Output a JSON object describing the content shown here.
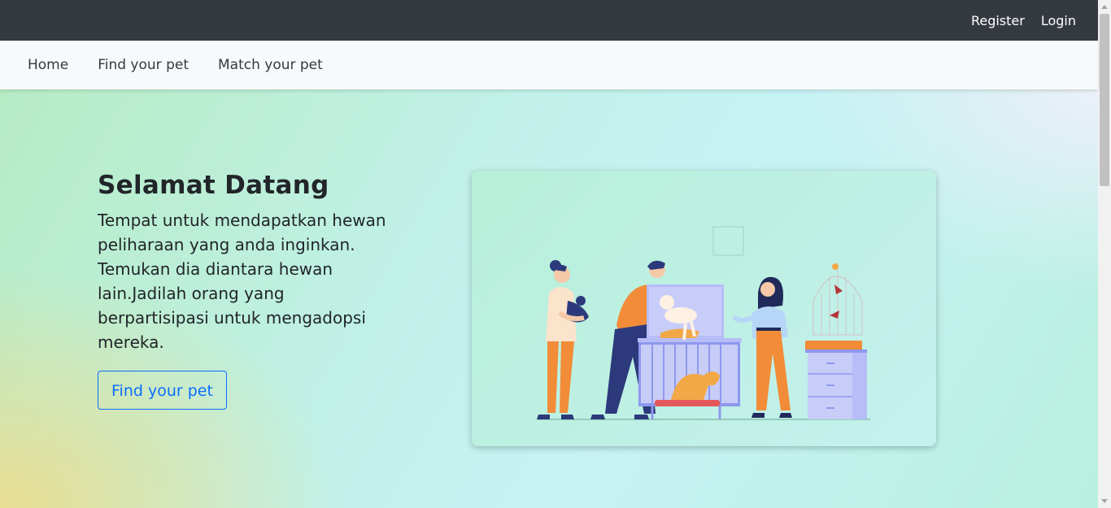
{
  "topbar": {
    "register_label": "Register",
    "login_label": "Login"
  },
  "nav": {
    "items": [
      {
        "label": "Home"
      },
      {
        "label": "Find your pet"
      },
      {
        "label": "Match your pet"
      }
    ]
  },
  "hero": {
    "title": "Selamat Datang",
    "description": "Tempat untuk mendapatkan hewan peliharaan yang anda inginkan. Temukan dia diantara hewan lain.Jadilah orang yang berpartisipasi untuk mengadopsi mereka.",
    "button_label": "Find your pet"
  },
  "colors": {
    "topbar_bg": "#343a40",
    "navbar_bg": "#f8f9fa",
    "accent": "#0d6efd",
    "illustration_orange": "#f28c38",
    "illustration_navy": "#2c3a7c",
    "illustration_lavender": "#b7bdf7"
  },
  "icons": {
    "illustration": "pet-adoption-illustration"
  }
}
